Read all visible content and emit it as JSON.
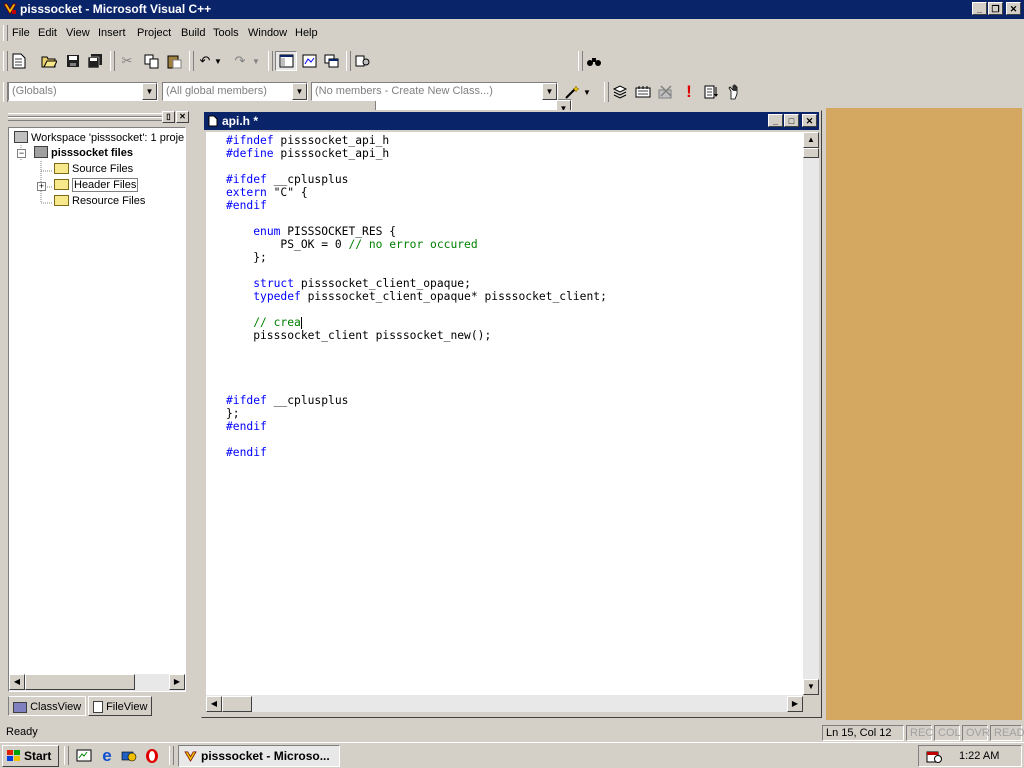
{
  "window": {
    "title": "pisssocket - Microsoft Visual C++",
    "minimize": "_",
    "restore": "❐",
    "close": "✕"
  },
  "menu": [
    "File",
    "Edit",
    "View",
    "Insert",
    "Project",
    "Build",
    "Tools",
    "Window",
    "Help"
  ],
  "toolbar": {
    "find_combo_value": ""
  },
  "wizardbar": {
    "scope": "(Globals)",
    "filter": "(All global members)",
    "members": "(No members - Create New Class...)"
  },
  "workspace": {
    "root": "Workspace 'pisssocket': 1 proje",
    "project": "pisssocket files",
    "folders": [
      "Source Files",
      "Header Files",
      "Resource Files"
    ],
    "tabs": [
      "ClassView",
      "FileView"
    ]
  },
  "editor": {
    "title": "api.h *",
    "lines": [
      [
        {
          "t": "#ifndef",
          "c": "kw"
        },
        {
          "t": " pisssocket_api_h"
        }
      ],
      [
        {
          "t": "#define",
          "c": "kw"
        },
        {
          "t": " pisssocket_api_h"
        }
      ],
      [],
      [
        {
          "t": "#ifdef",
          "c": "kw"
        },
        {
          "t": " __cplusplus"
        }
      ],
      [
        {
          "t": "extern",
          "c": "kw"
        },
        {
          "t": " \"C\" {"
        }
      ],
      [
        {
          "t": "#endif",
          "c": "kw"
        }
      ],
      [],
      [
        {
          "t": "    "
        },
        {
          "t": "enum",
          "c": "kw"
        },
        {
          "t": " PISSSOCKET_RES {"
        }
      ],
      [
        {
          "t": "        PS_OK = 0 "
        },
        {
          "t": "// no error occured",
          "c": "cm"
        }
      ],
      [
        {
          "t": "    };"
        }
      ],
      [],
      [
        {
          "t": "    "
        },
        {
          "t": "struct",
          "c": "kw"
        },
        {
          "t": " pisssocket_client_opaque;"
        }
      ],
      [
        {
          "t": "    "
        },
        {
          "t": "typedef",
          "c": "kw"
        },
        {
          "t": " pisssocket_client_opaque* pisssocket_client;"
        }
      ],
      [],
      [
        {
          "t": "    "
        },
        {
          "t": "// crea",
          "c": "cm"
        },
        {
          "t": "",
          "c": "caret"
        }
      ],
      [
        {
          "t": "    pisssocket_client pisssocket_new();"
        }
      ],
      [],
      [],
      [],
      [],
      [
        {
          "t": "#ifdef",
          "c": "kw"
        },
        {
          "t": " __cplusplus"
        }
      ],
      [
        {
          "t": "};"
        }
      ],
      [
        {
          "t": "#endif",
          "c": "kw"
        }
      ],
      [],
      [
        {
          "t": "#endif",
          "c": "kw"
        }
      ]
    ]
  },
  "status": {
    "message": "Ready",
    "position": "Ln 15, Col 12",
    "indicators": [
      "REC",
      "COL",
      "OVR",
      "READ"
    ]
  },
  "taskbar": {
    "start": "Start",
    "task": "pisssocket - Microso...",
    "clock": "1:22 AM"
  }
}
